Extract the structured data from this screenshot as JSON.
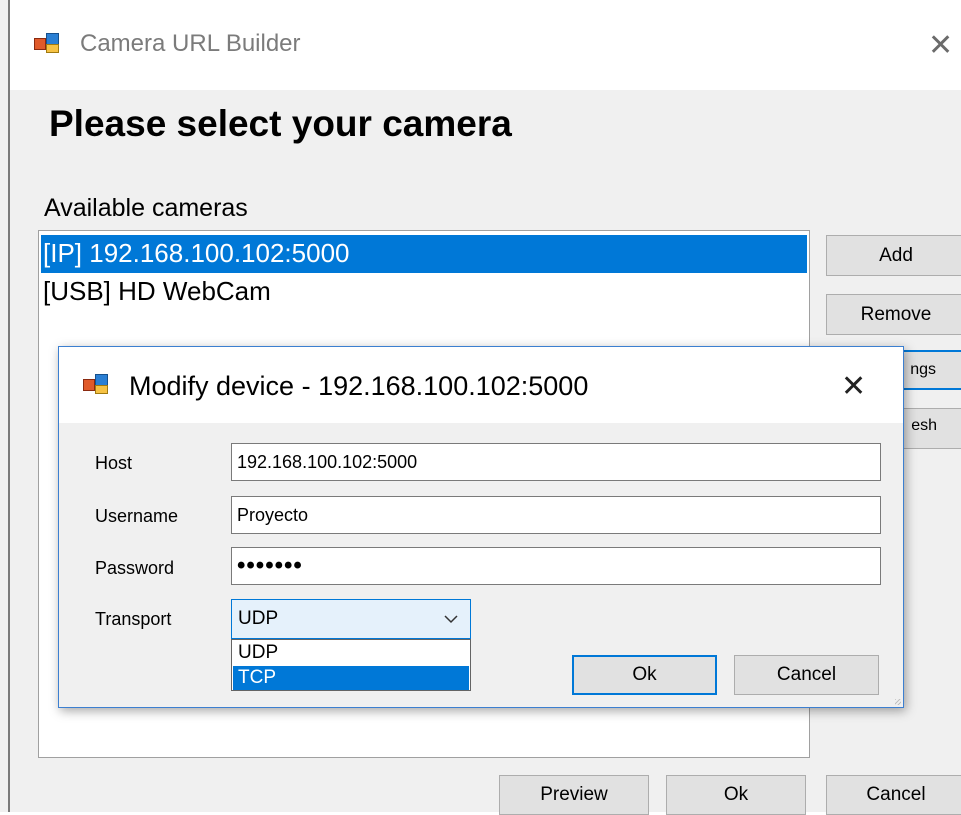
{
  "main_window": {
    "title": "Camera URL Builder",
    "heading": "Please select your camera",
    "available_label": "Available cameras",
    "cameras": [
      "[IP] 192.168.100.102:5000",
      "[USB] HD WebCam"
    ],
    "selected_camera_index": 0,
    "side_buttons": {
      "add": "Add",
      "remove": "Remove",
      "settings_partial": "ngs",
      "refresh_partial": "esh"
    },
    "bottom_buttons": {
      "preview": "Preview",
      "ok": "Ok",
      "cancel": "Cancel"
    }
  },
  "dialog": {
    "title": "Modify device - 192.168.100.102:5000",
    "fields": {
      "host_label": "Host",
      "host_value": "192.168.100.102:5000",
      "username_label": "Username",
      "username_value": "Proyecto",
      "password_label": "Password",
      "password_value": "•••••••",
      "transport_label": "Transport",
      "transport_value": "UDP"
    },
    "transport_options": [
      "UDP",
      "TCP"
    ],
    "transport_highlighted": "TCP",
    "ok_label": "Ok",
    "cancel_label": "Cancel"
  },
  "colors": {
    "selection": "#0078d7",
    "window_bg": "#f0f0f0",
    "titlebar_bg": "#ffffff"
  },
  "icons": [
    "app-icon",
    "close-icon",
    "chevron-down-icon"
  ]
}
